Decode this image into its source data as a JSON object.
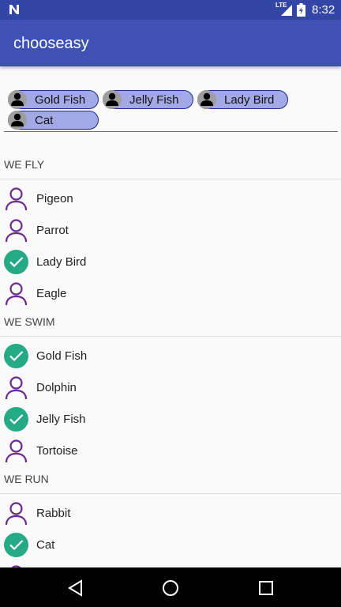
{
  "status_bar": {
    "network": "LTE",
    "time": "8:32"
  },
  "app_bar": {
    "title": "chooseasy"
  },
  "chips": [
    {
      "label": "Gold Fish"
    },
    {
      "label": "Jelly Fish"
    },
    {
      "label": "Lady Bird"
    },
    {
      "label": "Cat"
    }
  ],
  "sections": [
    {
      "header": "WE FLY",
      "items": [
        {
          "label": "Pigeon",
          "selected": false
        },
        {
          "label": "Parrot",
          "selected": false
        },
        {
          "label": "Lady Bird",
          "selected": true
        },
        {
          "label": "Eagle",
          "selected": false
        }
      ]
    },
    {
      "header": "WE SWIM",
      "items": [
        {
          "label": "Gold Fish",
          "selected": true
        },
        {
          "label": "Dolphin",
          "selected": false
        },
        {
          "label": "Jelly Fish",
          "selected": true
        },
        {
          "label": "Tortoise",
          "selected": false
        }
      ]
    },
    {
      "header": "WE RUN",
      "items": [
        {
          "label": "Rabbit",
          "selected": false
        },
        {
          "label": "Cat",
          "selected": true
        }
      ]
    }
  ],
  "colors": {
    "primary": "#3f51b5",
    "primary_dark": "#3346a5",
    "chip_fill": "#a2a9e4",
    "check_green": "#26a985",
    "person_purple": "#6a2a8e"
  },
  "icons": {
    "unselected": "person-outline-icon",
    "selected": "checkmark-circle-icon",
    "chip_avatar": "person-icon"
  }
}
